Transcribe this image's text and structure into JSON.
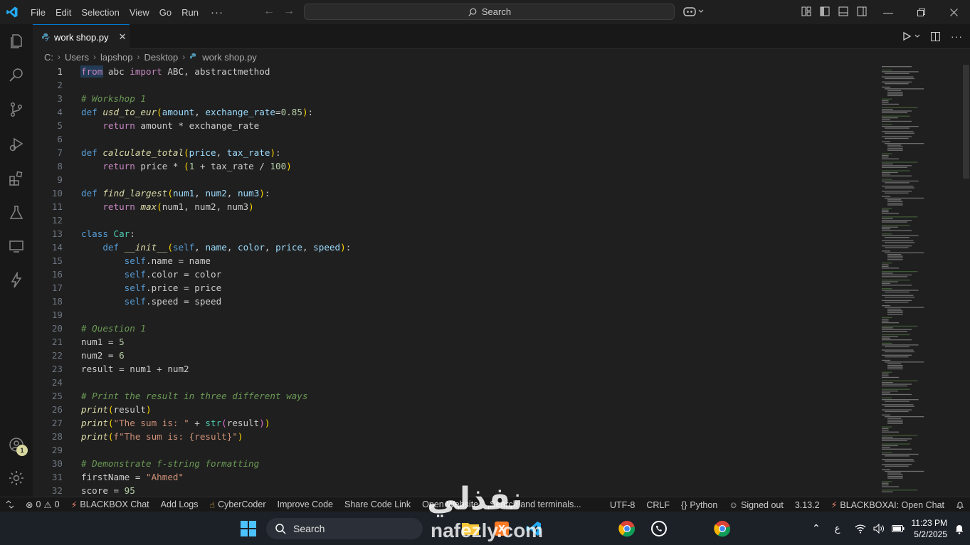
{
  "menu": [
    "File",
    "Edit",
    "Selection",
    "View",
    "Go",
    "Run",
    "···"
  ],
  "search": {
    "label": "Search"
  },
  "tab": {
    "filename": "work shop.py"
  },
  "breadcrumb": [
    "C:",
    "Users",
    "lapshop",
    "Desktop",
    "work shop.py"
  ],
  "status": {
    "errors": "0",
    "warnings": "0",
    "left_items": [
      "BLACKBOX Chat",
      "Add Logs",
      "CyberCoder",
      "Improve Code",
      "Share Code Link",
      "Open Website",
      "Search and terminals..."
    ],
    "encoding": "UTF-8",
    "eol": "CRLF",
    "language": "Python",
    "account": "Signed out",
    "version": "3.13.2",
    "blackbox": "BLACKBOXAI: Open Chat"
  },
  "activity_badge": "1",
  "taskbar": {
    "search_label": "Search",
    "time": "11:23 PM",
    "date": "5/2/2025",
    "lang": "ع"
  },
  "watermark": {
    "text": "نفذلي",
    "site": "nafezly.com"
  },
  "code_lines": [
    "from abc import ABC, abstractmethod",
    "",
    "# Workshop 1",
    "def usd_to_eur(amount, exchange_rate=0.85):",
    "    return amount * exchange_rate",
    "",
    "def calculate_total(price, tax_rate):",
    "    return price * (1 + tax_rate / 100)",
    "",
    "def find_largest(num1, num2, num3):",
    "    return max(num1, num2, num3)",
    "",
    "class Car:",
    "    def __init__(self, name, color, price, speed):",
    "        self.name = name",
    "        self.color = color",
    "        self.price = price",
    "        self.speed = speed",
    "",
    "# Question 1",
    "num1 = 5",
    "num2 = 6",
    "result = num1 + num2",
    "",
    "# Print the result in three different ways",
    "print(result)",
    "print(\"The sum is: \" + str(result))",
    "print(f\"The sum is: {result}\")",
    "",
    "# Demonstrate f-string formatting",
    "firstName = \"Ahmed\"",
    "score = 95"
  ]
}
